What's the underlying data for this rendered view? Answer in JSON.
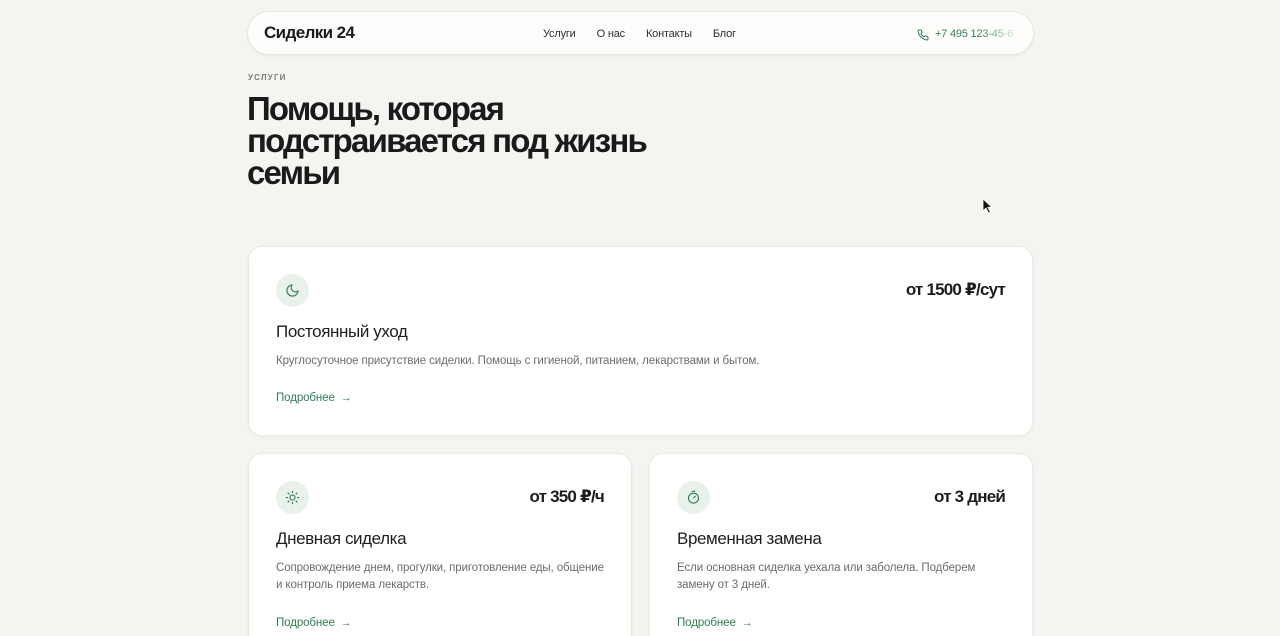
{
  "header": {
    "logo": "Сиделки 24",
    "nav": [
      "Услуги",
      "О нас",
      "Контакты",
      "Блог"
    ],
    "phone": "+7 495 123-45-6"
  },
  "hero": {
    "eyebrow": "УСЛУГИ",
    "title": "Помощь, которая подстраивается под жизнь семьи"
  },
  "services": [
    {
      "icon": "moon-icon",
      "price": "от 1500 ₽/сут",
      "title": "Постоянный уход",
      "description": "Круглосуточное присутствие сиделки. Помощь с гигиеной, питанием, лекарствами и бытом.",
      "link": "Подробнее"
    },
    {
      "icon": "sun-icon",
      "price": "от 350 ₽/ч",
      "title": "Дневная сиделка",
      "description": "Сопровождение днем, прогулки, приготовление еды, общение и контроль приема лекарств.",
      "link": "Подробнее"
    },
    {
      "icon": "timer-icon",
      "price": "от 3 дней",
      "title": "Временная замена",
      "description": "Если основная сиделка уехала или заболела. Подберем замену от 3 дней.",
      "link": "Подробнее"
    }
  ],
  "colors": {
    "accent": "#2f7d52",
    "background": "#f5f4f1",
    "icon_bg": "#e8f1ea"
  }
}
